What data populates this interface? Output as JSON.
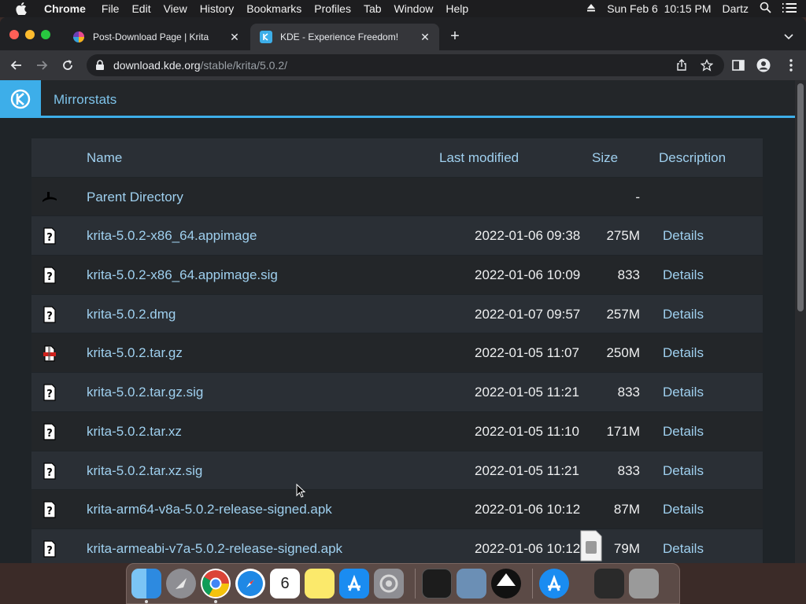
{
  "menubar": {
    "app": "Chrome",
    "items": [
      "File",
      "Edit",
      "View",
      "History",
      "Bookmarks",
      "Profiles",
      "Tab",
      "Window",
      "Help"
    ],
    "datetime": "Sun Feb 6  10:15 PM",
    "user": "Dartz"
  },
  "tabs": [
    {
      "title": "Post-Download Page | Krita",
      "active": false
    },
    {
      "title": "KDE - Experience Freedom!",
      "active": true
    }
  ],
  "address": {
    "host": "download.kde.org",
    "path": "/stable/krita/5.0.2/"
  },
  "header": {
    "title": "Mirrorstats"
  },
  "listing": {
    "columns": {
      "name": "Name",
      "modified": "Last modified",
      "size": "Size",
      "description": "Description"
    },
    "parent": {
      "name": "Parent Directory",
      "size": "-"
    },
    "rows": [
      {
        "name": "krita-5.0.2-x86_64.appimage",
        "modified": "2022-01-06 09:38",
        "size": "275M",
        "description": "Details",
        "icon": "unknown-file-icon"
      },
      {
        "name": "krita-5.0.2-x86_64.appimage.sig",
        "modified": "2022-01-06 10:09",
        "size": "833",
        "description": "Details",
        "icon": "unknown-file-icon"
      },
      {
        "name": "krita-5.0.2.dmg",
        "modified": "2022-01-07 09:57",
        "size": "257M",
        "description": "Details",
        "icon": "unknown-file-icon"
      },
      {
        "name": "krita-5.0.2.tar.gz",
        "modified": "2022-01-05 11:07",
        "size": "250M",
        "description": "Details",
        "icon": "archive-icon"
      },
      {
        "name": "krita-5.0.2.tar.gz.sig",
        "modified": "2022-01-05 11:21",
        "size": "833",
        "description": "Details",
        "icon": "unknown-file-icon"
      },
      {
        "name": "krita-5.0.2.tar.xz",
        "modified": "2022-01-05 11:10",
        "size": "171M",
        "description": "Details",
        "icon": "unknown-file-icon"
      },
      {
        "name": "krita-5.0.2.tar.xz.sig",
        "modified": "2022-01-05 11:21",
        "size": "833",
        "description": "Details",
        "icon": "unknown-file-icon"
      },
      {
        "name": "krita-arm64-v8a-5.0.2-release-signed.apk",
        "modified": "2022-01-06 10:12",
        "size": "87M",
        "description": "Details",
        "icon": "unknown-file-icon"
      },
      {
        "name": "krita-armeabi-v7a-5.0.2-release-signed.apk",
        "modified": "2022-01-06 10:12",
        "size": "79M",
        "description": "Details",
        "icon": "unknown-file-icon"
      }
    ]
  },
  "colors": {
    "kde_blue": "#3daee9",
    "link": "#9fd0ef",
    "row_odd": "#2a2f35",
    "row_even": "#232629"
  },
  "dock": [
    "Finder",
    "Launchpad",
    "Chrome",
    "Safari",
    "Calendar",
    "Notes",
    "App Store",
    "System Preferences",
    "Terminal",
    "Preview",
    "Inkscape",
    "App Store",
    "Downloads",
    "Trash"
  ],
  "calendar_day": "6"
}
